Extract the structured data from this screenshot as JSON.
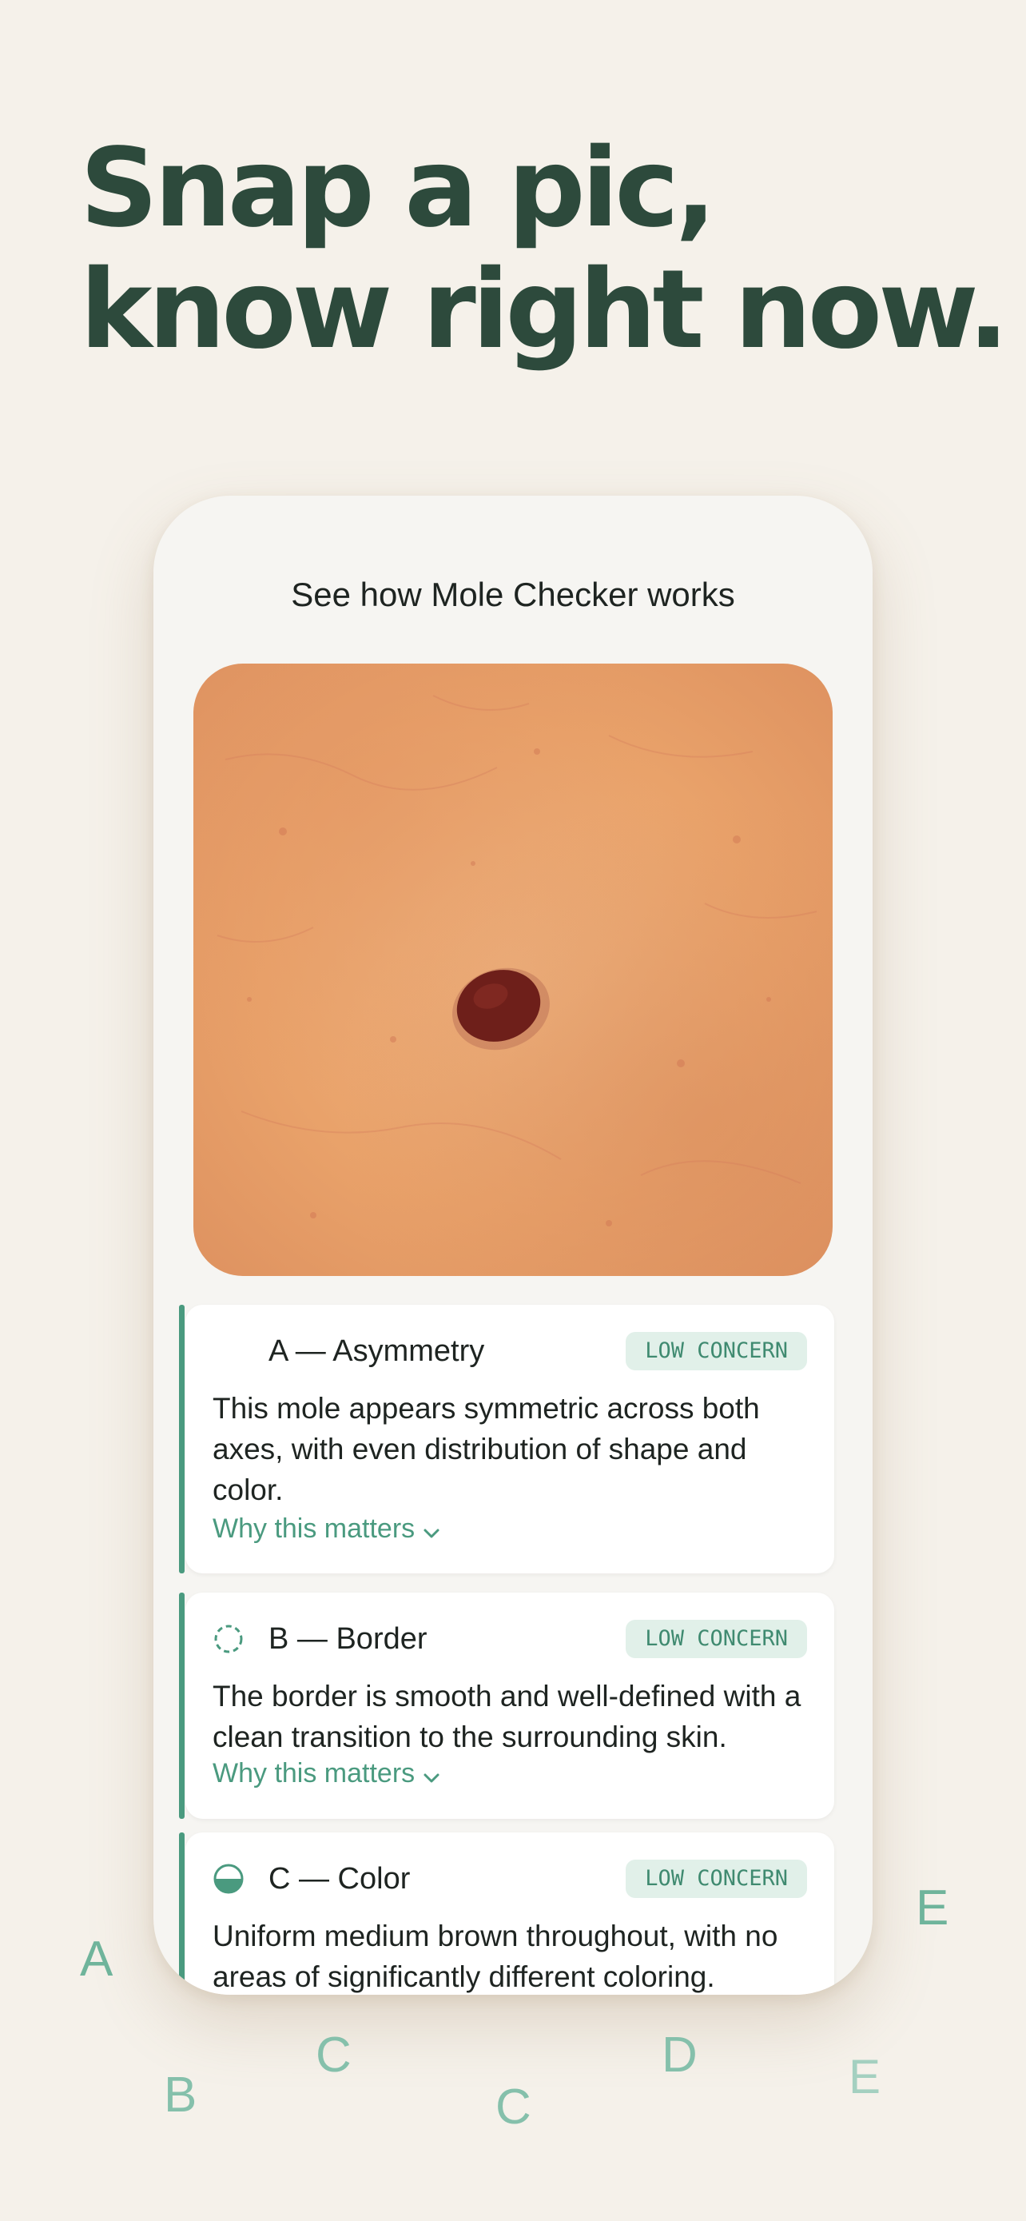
{
  "headline": {
    "line1": "Snap a pic,",
    "line2": "know right now."
  },
  "demo": {
    "title": "See how Mole Checker works",
    "cards": [
      {
        "icon": "asymmetry-icon",
        "title": "A — Asymmetry",
        "badge": "LOW CONCERN",
        "body": "This mole appears symmetric across both axes, with even distribution of shape and color.",
        "link": "Why this matters"
      },
      {
        "icon": "dashed-circle-icon",
        "title": "B — Border",
        "badge": "LOW CONCERN",
        "body": "The border is smooth and well-defined with a clean transition to the surrounding skin.",
        "link": "Why this matters"
      },
      {
        "icon": "half-filled-circle-icon",
        "title": "C — Color",
        "badge": "LOW CONCERN",
        "body": "Uniform medium brown throughout, with no areas of significantly different coloring."
      }
    ]
  },
  "decor_letters": [
    "A",
    "B",
    "C",
    "C",
    "D",
    "E",
    "E"
  ],
  "colors": {
    "background": "#f5f1ea",
    "headline": "#2d4a3c",
    "accent": "#4a9a7f",
    "badge_bg": "#e1f0e9",
    "mole": "#6e1f1a"
  }
}
